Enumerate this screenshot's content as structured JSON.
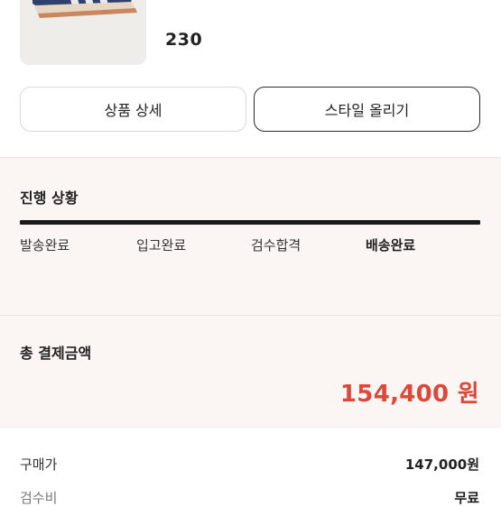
{
  "product": {
    "image_icon": "sneaker-image",
    "size": "230"
  },
  "actions": {
    "detail_label": "상품 상세",
    "style_label": "스타일 올리기"
  },
  "progress": {
    "title": "진행 상황",
    "steps": [
      "발송완료",
      "입고완료",
      "검수합격",
      "배송완료"
    ],
    "current_step_index": 3,
    "bar_color": "#1a1a1a"
  },
  "payment": {
    "title": "총 결제금액",
    "total": "154,400 원",
    "total_color": "#e0473b"
  },
  "breakdown": {
    "purchase_label": "구매가",
    "purchase_value": "147,000원",
    "inspection_label": "검수비",
    "inspection_value": "무료"
  },
  "colors": {
    "section_bg": "#fbf6f4"
  }
}
